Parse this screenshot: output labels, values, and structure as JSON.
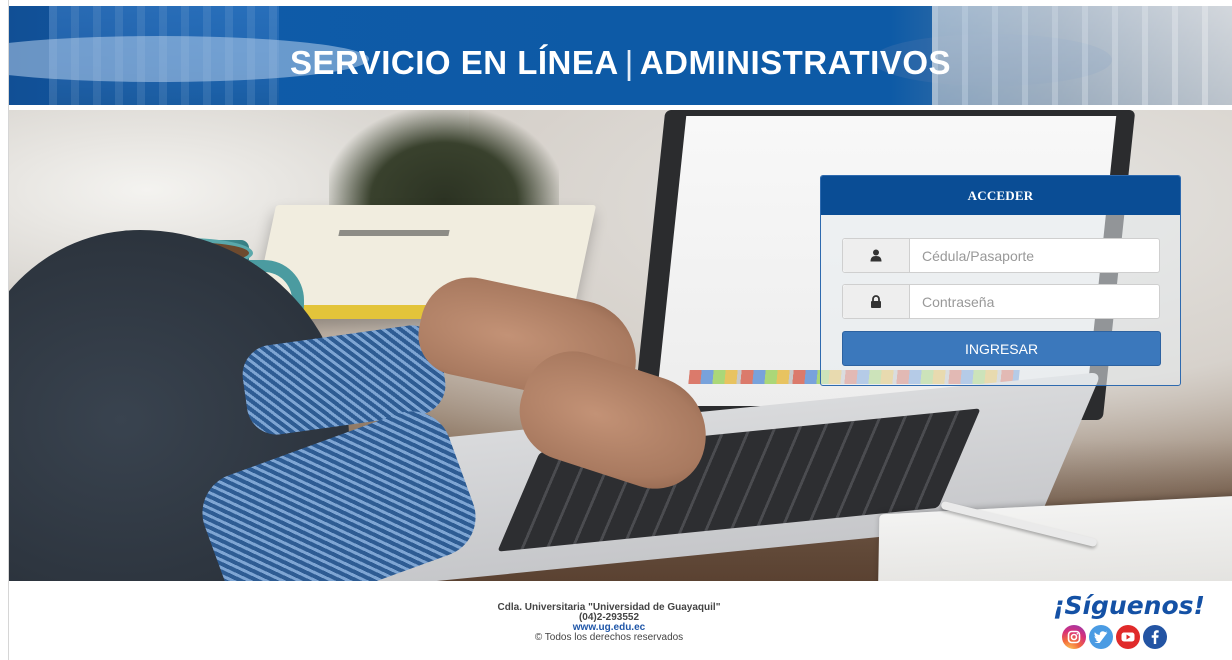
{
  "header": {
    "title_left": "SERVICIO EN LÍNEA",
    "separator": "|",
    "title_right": "ADMINISTRATIVOS"
  },
  "login": {
    "heading": "ACCEDER",
    "user_placeholder": "Cédula/Pasaporte",
    "user_value": "",
    "user_icon": "user-icon",
    "password_placeholder": "Contraseña",
    "password_value": "",
    "password_icon": "lock-icon",
    "submit_label": "INGRESAR"
  },
  "footer": {
    "address": "Cdla. Universitaria \"Universidad de Guayaquil\"",
    "phone": "(04)2-293552",
    "website": "www.ug.edu.ec",
    "copyright": "© Todos los derechos reservados",
    "follow_label": "¡Síguenos!",
    "social": [
      "instagram-icon",
      "twitter-icon",
      "youtube-icon",
      "facebook-icon"
    ]
  },
  "colors": {
    "header_blue": "#0d5aa6",
    "panel_header": "#0a4d95",
    "button": "#3b78bc",
    "follow_text": "#1451a5"
  }
}
